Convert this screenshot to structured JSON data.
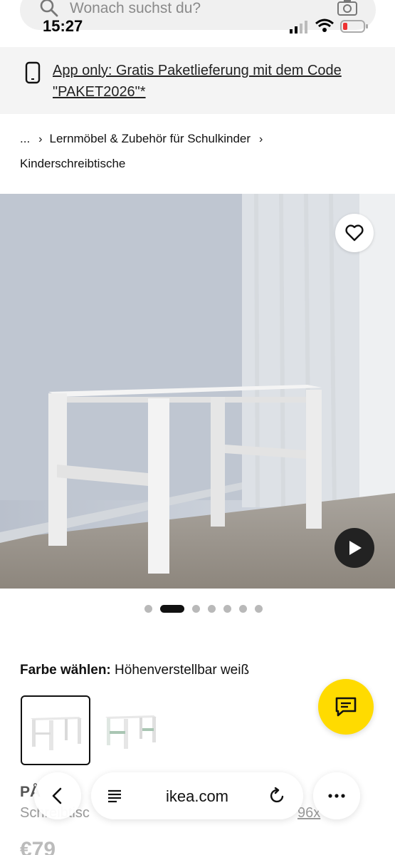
{
  "search": {
    "placeholder": "Wonach suchst du?"
  },
  "status": {
    "time": "15:27"
  },
  "promo": {
    "text": "App only: Gratis Paketlieferung mit dem Code \"PAKET2026\"*"
  },
  "breadcrumb": {
    "ellipsis": "...",
    "items": [
      "Lernmöbel & Zubehör für Schulkinder",
      "Kinderschreibtische"
    ]
  },
  "gallery": {
    "total": 7,
    "active": 1
  },
  "color": {
    "label": "Farbe wählen:",
    "value": "Höhenverstellbar weiß",
    "options": [
      "white",
      "white-green"
    ]
  },
  "product": {
    "name": "PÅ",
    "desc_left": "Schreibtisc",
    "desc_right": "96x",
    "price": "€79"
  },
  "browser": {
    "url": "ikea.com"
  },
  "colors": {
    "accent": "#ffdb00",
    "battery_low": "#e33"
  },
  "icons": [
    "search-icon",
    "camera-icon",
    "phone-icon",
    "heart-icon",
    "play-icon",
    "chat-icon",
    "back-icon",
    "reader-icon",
    "reload-icon",
    "more-icon"
  ]
}
